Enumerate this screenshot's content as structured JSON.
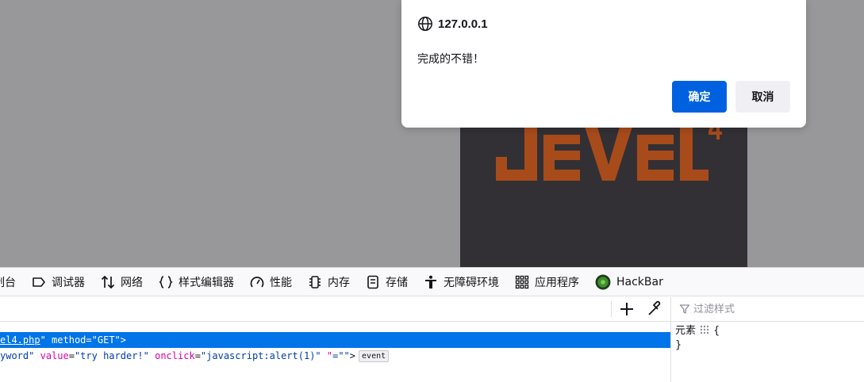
{
  "dialog": {
    "origin": "127.0.0.1",
    "message": "完成的不错！",
    "ok_label": "确定",
    "cancel_label": "取消"
  },
  "page": {
    "logo_icon": "level-4-logo",
    "colors": {
      "dim_bg": "#98989a",
      "image_bg": "#323034",
      "logo": "#a84b1b"
    }
  },
  "devtools": {
    "tabs": [
      {
        "label": "控制台",
        "icon": "console-icon"
      },
      {
        "label": "调试器",
        "icon": "debugger-icon"
      },
      {
        "label": "网络",
        "icon": "network-icon"
      },
      {
        "label": "样式编辑器",
        "icon": "style-editor-icon"
      },
      {
        "label": "性能",
        "icon": "performance-icon"
      },
      {
        "label": "内存",
        "icon": "memory-icon"
      },
      {
        "label": "存储",
        "icon": "storage-icon"
      },
      {
        "label": "无障碍环境",
        "icon": "accessibility-icon"
      },
      {
        "label": "应用程序",
        "icon": "application-icon"
      },
      {
        "label": "HackBar",
        "icon": "hackbar-icon"
      }
    ],
    "markup": {
      "form_line": {
        "action_partial": "el4.php",
        "quote_close": "\"",
        "method_attr": "method",
        "method_val": "\"GET\"",
        "tail": ">"
      },
      "input_line": {
        "name_val_partial": "yword\"",
        "value_attr": "value",
        "value_val": "\"try harder!\"",
        "onclick_attr": "onclick",
        "onclick_val": "\"javascript:alert(1)\"",
        "extra_attr": "\"",
        "extra_val": "=\"\"",
        "tail": ">",
        "event_badge": "event"
      }
    },
    "rules": {
      "filter_placeholder": "过滤样式",
      "selector": "元素",
      "open_brace": "{",
      "close_brace": "}"
    },
    "accent": "#0074e8"
  }
}
